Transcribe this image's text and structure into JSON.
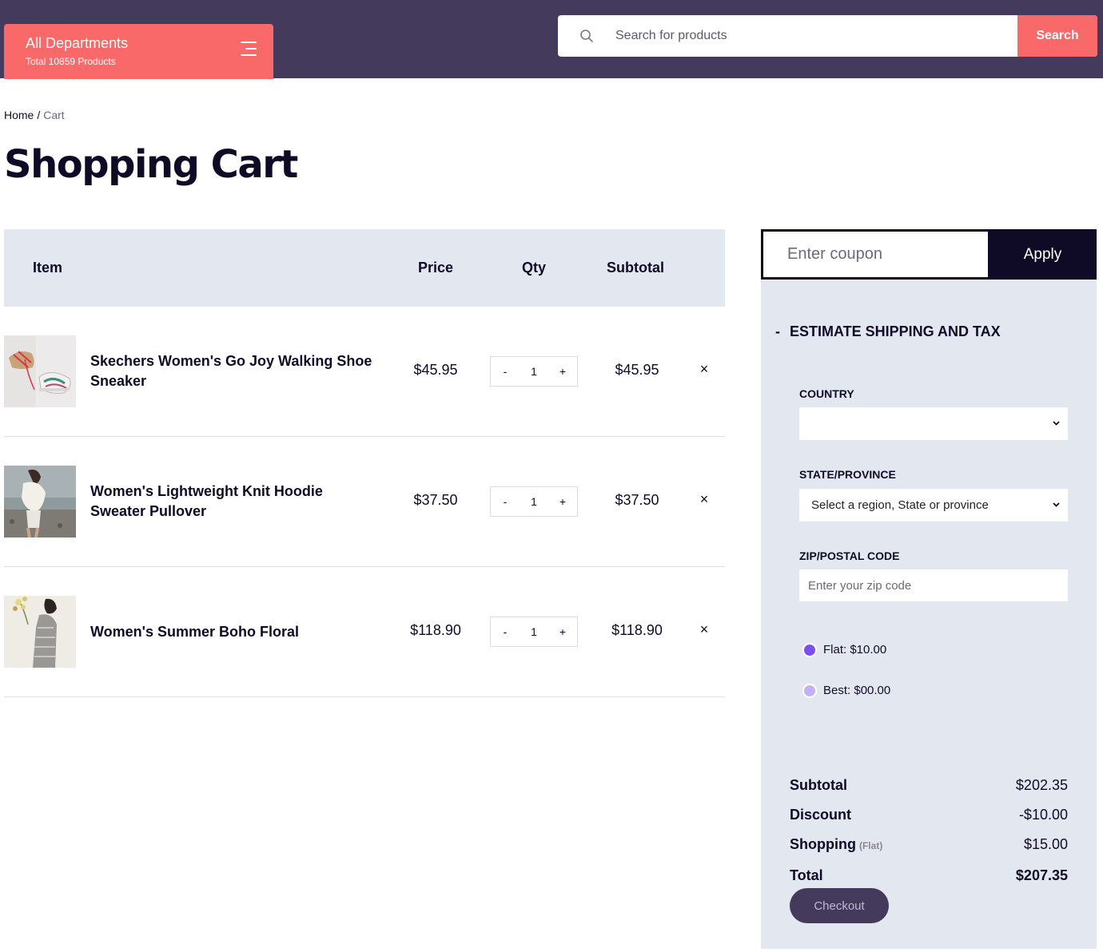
{
  "header": {
    "departments_title": "All Departments",
    "departments_subtitle": "Total 10859 Products",
    "search_placeholder": "Search for products",
    "search_button": "Search"
  },
  "breadcrumb": {
    "home": "Home",
    "separator": "/",
    "current": "Cart"
  },
  "page_title": "Shopping Cart",
  "cart": {
    "columns": {
      "item": "Item",
      "price": "Price",
      "qty": "Qty",
      "subtotal": "Subtotal"
    },
    "items": [
      {
        "name": "Skechers Women's Go Joy Walking Shoe Sneaker",
        "price": "$45.95",
        "qty": "1",
        "subtotal": "$45.95"
      },
      {
        "name": "Women's Lightweight Knit Hoodie Sweater Pullover",
        "price": "$37.50",
        "qty": "1",
        "subtotal": "$37.50"
      },
      {
        "name": "Women's Summer Boho Floral",
        "price": "$118.90",
        "qty": "1",
        "subtotal": "$118.90"
      }
    ],
    "qty_minus": "-",
    "qty_plus": "+",
    "remove": "×"
  },
  "coupon": {
    "placeholder": "Enter coupon",
    "button": "Apply"
  },
  "shipping": {
    "toggle": "-",
    "title": "ESTIMATE SHIPPING AND TAX",
    "country_label": "COUNTRY",
    "country_value": "",
    "state_label": "STATE/PROVINCE",
    "state_value": "Select a region, State or province",
    "zip_label": "ZIP/POSTAL CODE",
    "zip_placeholder": "Enter your zip code",
    "options": [
      {
        "label": "Flat: $10.00",
        "selected": true
      },
      {
        "label": "Best: $00.00",
        "selected": false
      }
    ]
  },
  "totals": {
    "subtotal_label": "Subtotal",
    "subtotal_value": "$202.35",
    "discount_label": "Discount",
    "discount_value": "-$10.00",
    "shipping_label": "Shopping",
    "shipping_note": "(Flat)",
    "shipping_value": "$15.00",
    "total_label": "Total",
    "total_value": "$207.35",
    "checkout_button": "Checkout"
  },
  "colors": {
    "topbar": "#433a5c",
    "accent": "#f96969",
    "dark": "#0f0b27",
    "panel": "#e3e7f0",
    "radio_selected": "#7b4ff0",
    "radio_unselected": "#c4b0f5"
  },
  "icons": {
    "search": "search-icon",
    "menu": "hamburger-menu-icon",
    "chevron": "chevron-down-icon"
  }
}
